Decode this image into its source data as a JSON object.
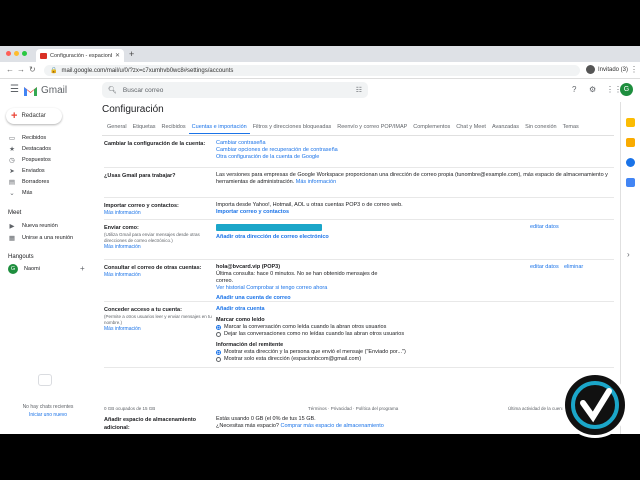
{
  "browser": {
    "tab_title": "Configuración - espacionbcom@",
    "url": "mail.google.com/mail/u/0/?zx=c7xumhvb0wc8#settings/accounts",
    "profile_label": "Invitado (3)"
  },
  "header": {
    "app_name": "Gmail",
    "search_placeholder": "Buscar correo",
    "avatar_letter": "G"
  },
  "sidebar": {
    "compose_label": "Redactar",
    "items": [
      {
        "label": "Recibidos",
        "icon": "inbox-icon"
      },
      {
        "label": "Destacados",
        "icon": "star-icon"
      },
      {
        "label": "Pospuestos",
        "icon": "clock-icon"
      },
      {
        "label": "Enviados",
        "icon": "send-icon"
      },
      {
        "label": "Borradores",
        "icon": "draft-icon"
      },
      {
        "label": "Más",
        "icon": "chevron-down-icon"
      }
    ],
    "meet_title": "Meet",
    "meet_items": [
      {
        "label": "Nueva reunión"
      },
      {
        "label": "Unirse a una reunión"
      }
    ],
    "hangouts_title": "Hangouts",
    "hangouts_user": "Naomi",
    "hangouts_avatar": "G",
    "empty_msg": "No hay chats recientes",
    "empty_link": "Iniciar uno nuevo"
  },
  "main": {
    "title": "Configuración",
    "tabs": [
      "General",
      "Etiquetas",
      "Recibidos",
      "Cuentas e importación",
      "Filtros y direcciones bloqueadas",
      "Reenvío y correo POP/IMAP",
      "Complementos",
      "Chat y Meet",
      "Avanzadas",
      "Sin conexión",
      "Temas"
    ],
    "active_tab": "Cuentas e importación",
    "more_info": "Más información",
    "rows": {
      "change_account": {
        "label": "Cambiar la configuración de la cuenta:",
        "links": [
          "Cambiar contraseña",
          "Cambiar opciones de recuperación de contraseña",
          "Otra configuración de la cuenta de Google"
        ]
      },
      "work": {
        "label": "¿Usas Gmail para trabajar?",
        "text": "Las versiones para empresas de Google Workspace proporcionan una dirección de correo propia (tunombre@example.com), más espacio de almacenamiento y herramientas de administración.",
        "link": "Más información"
      },
      "import": {
        "label": "Importar correo y contactos:",
        "text": "Importa desde Yahoo!, Hotmail, AOL u otras cuentas POP3 o de correo web.",
        "link": "Importar correo y contactos"
      },
      "send_as": {
        "label": "Enviar como:",
        "sub": "(Utiliza Gmail para enviar mensajes desde otras direcciones de correo electrónico.)",
        "link": "Añadir otra dirección de correo electrónico",
        "action": "editar datos"
      },
      "check_mail": {
        "label": "Consultar el correo de otras cuentas:",
        "account": "hola@bvcard.vip (POP3)",
        "status": "Última consulta: hace 0 minutos. No se han obtenido mensajes de correo.",
        "history": "Ver historial",
        "check_now": "Comprobar si tengo correo ahora",
        "add_link": "Añadir una cuenta de correo",
        "action_edit": "editar datos",
        "action_delete": "eliminar"
      },
      "grant_access": {
        "label": "Conceder acceso a tu cuenta:",
        "sub": "(Permite a otros usuarios leer y enviar mensajes en tu nombre.)",
        "link": "Añadir otra cuenta",
        "mark_title": "Marcar como leído",
        "mark_options": [
          "Marcar la conversación como leída cuando la abran otros usuarios",
          "Dejar las conversaciones como no leídas cuando las abran otros usuarios"
        ],
        "sender_title": "Información del remitente",
        "sender_options": [
          "Mostrar esta dirección y la persona que envió el mensaje (\"Enviado por...\")",
          "Mostrar solo esta dirección (espacionbcom@gmail.com)"
        ]
      },
      "storage": {
        "label": "Añadir espacio de almacenamiento adicional:",
        "text": "Estás usando 0 GB (el 0% de tus 15 GB.",
        "question": "¿Necesitas más espacio?",
        "link": "Comprar más espacio de almacenamiento"
      }
    },
    "footer": {
      "storage": "0 GB ocupados de 15 GB",
      "center": "Términos · Privacidad · Política del programa",
      "right": "Última actividad de la cuenta"
    }
  },
  "colors": {
    "accent": "#1a73e8",
    "bar": "#1ba6c9",
    "avatar": "#1e8e3e"
  }
}
